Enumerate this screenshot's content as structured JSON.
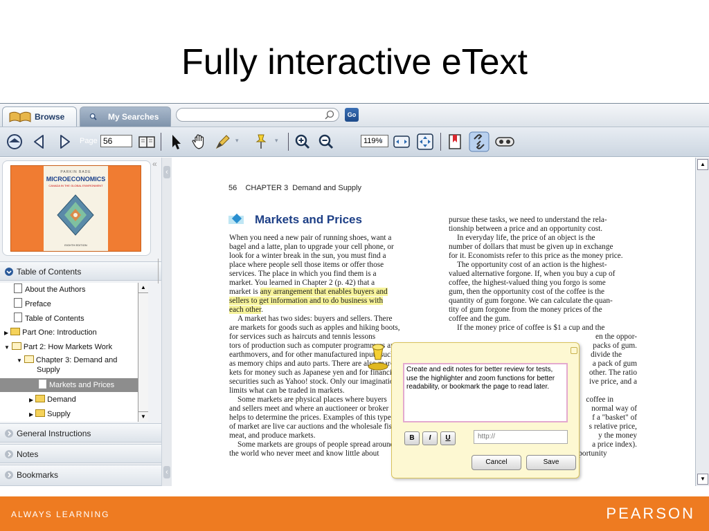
{
  "slide": {
    "title": "Fully interactive eText",
    "footer_left": "ALWAYS LEARNING",
    "footer_right": "PEARSON"
  },
  "tabs": [
    {
      "label": "Browse",
      "active": true
    },
    {
      "label": "My Searches",
      "active": false
    }
  ],
  "search": {
    "value": "",
    "go_label": "Go"
  },
  "toolbar": {
    "page_label": "Page",
    "page_value": "56",
    "zoom_value": "119%"
  },
  "book": {
    "authors": "PARKIN  BADE",
    "title": "MICROECONOMICS",
    "subtitle": "CANADA IN THE GLOBAL ENVIRONMENT",
    "edition": "EIGHTH EDITION"
  },
  "sidebar": {
    "toc_header": "Table of Contents",
    "toc_items": [
      "About the Authors",
      "Preface",
      "Table of Contents",
      "Part One: Introduction",
      "Part 2: How Markets Work",
      "Chapter 3: Demand and",
      "Supply",
      "Markets and Prices",
      "Demand",
      "Supply"
    ],
    "general_instructions": "General Instructions",
    "notes": "Notes",
    "bookmarks": "Bookmarks"
  },
  "page": {
    "header": "56    CHAPTER 3  Demand and Supply",
    "section_title": "Markets and Prices",
    "col1": [
      "When you need a new pair of running shoes, want a",
      "bagel and a latte, plan to upgrade your cell phone, or",
      "look for a winter break in the sun, you must find a",
      "place where people sell those items or offer those",
      "services. The place in which you find them is a",
      "market. You learned in Chapter 2 (p. 42) that a",
      "market is ",
      "any arrangement that enables buyers and",
      "sellers to get information and to do business with",
      "each other",
      ".",
      "A market has two sides: buyers and sellers. There",
      "are markets for goods such as apples and hiking boots,",
      "for services such as haircuts and tennis lessons",
      "tors of production such as computer programmers and",
      "earthmovers, and for other manufactured inputs such",
      "as memory chips and auto parts. There are also mar-",
      "kets for money such as Japanese yen and for financial",
      "securities such as Yahoo! stock. Only our imagination",
      "limits what can be traded in markets.",
      "Some markets are physical places where buyers",
      "and sellers meet and where an auctioneer or broker",
      "helps to determine the prices. Examples of this type",
      "of market are live car auctions and the wholesale fish,",
      "meat, and produce markets.",
      "Some markets are groups of people spread around",
      "the world who never meet and know little about"
    ],
    "col2": [
      "pursue these tasks, we need to understand the rela-",
      "tionship between a price and an opportunity cost.",
      "In everyday life, the price of an object is the",
      "number of dollars that must be given up in exchange",
      "for it. Economists refer to this price as the money price.",
      "The opportunity cost of an action is the highest-",
      "valued alternative forgone. If, when you buy a cup of",
      "coffee, the highest-valued thing you forgo is some",
      "gum, then the opportunity cost of the coffee is the",
      "quantity of gum forgone. We can calculate the quan-",
      "tity of gum forgone from the money prices of the",
      "coffee and the gum.",
      "If the money price of coffee is $1 a cup and the",
      "en the oppor-",
      "packs of gum.",
      "divide the",
      "a pack of gum",
      "other. The ratio",
      "ive price, and a",
      "",
      "coffee in",
      "normal way of",
      "f a \"basket\" of",
      "s relative price,",
      "y the money",
      "a price index).",
      "The resulting relative price tells us the opportunity"
    ]
  },
  "note": {
    "text": "Create and edit notes for better review for tests, use the highlighter and zoom functions for better readability, or bookmark the page to read later.",
    "bold": "B",
    "italic": "I",
    "underline": "U",
    "url_placeholder": "http://",
    "cancel": "Cancel",
    "save": "Save"
  },
  "colors": {
    "footer_orange": "#ee7b21",
    "highlight": "#f6f39a",
    "section_title": "#1d3f86",
    "note_bg": "#fdf8d2"
  }
}
